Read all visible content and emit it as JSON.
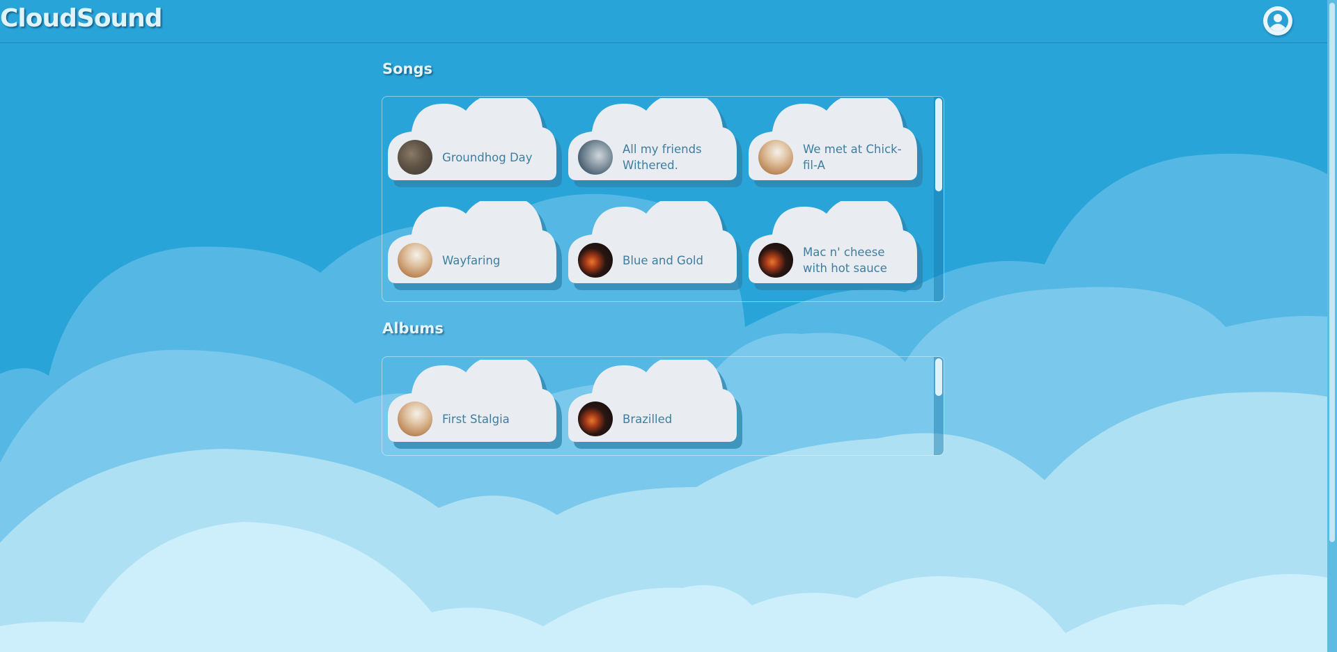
{
  "app": {
    "brand": "CloudSound",
    "accent_color": "#29a4d9",
    "user_icon": "user-avatar-icon"
  },
  "songs": {
    "title": "Songs",
    "items": [
      {
        "title": "Groundhog Day",
        "cover": "rocky-cover"
      },
      {
        "title": "All my friends Withered.",
        "cover": "bird-cover"
      },
      {
        "title": "We met at Chick-fil-A",
        "cover": "milkshake-cover"
      },
      {
        "title": "Wayfaring",
        "cover": "milkshake-cover"
      },
      {
        "title": "Blue and Gold",
        "cover": "fire-cover"
      },
      {
        "title": "Mac n' cheese with hot sauce",
        "cover": "fire-cover"
      }
    ]
  },
  "albums": {
    "title": "Albums",
    "items": [
      {
        "title": "First Stalgia",
        "cover": "milkshake-cover"
      },
      {
        "title": "Brazilled",
        "cover": "fire-cover"
      }
    ]
  }
}
